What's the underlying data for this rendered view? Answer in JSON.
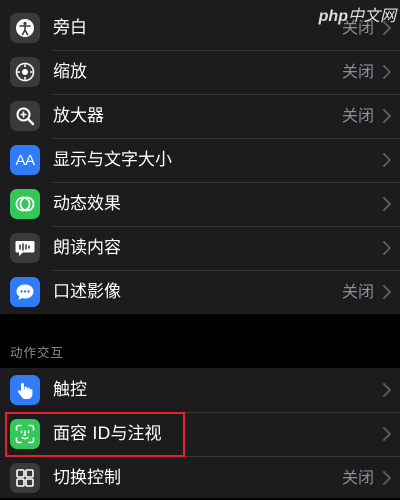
{
  "watermark": {
    "brand": "php",
    "site": "中文网"
  },
  "vision_group": {
    "items": [
      {
        "label": "旁白",
        "value": "关闭",
        "icon": "voiceover-icon",
        "icon_color": "#3a3a3c"
      },
      {
        "label": "缩放",
        "value": "关闭",
        "icon": "zoom-icon",
        "icon_color": "#3a3a3c"
      },
      {
        "label": "放大器",
        "value": "关闭",
        "icon": "magnifier-icon",
        "icon_color": "#3a3a3c"
      },
      {
        "label": "显示与文字大小",
        "value": "",
        "icon": "text-size-icon",
        "icon_glyph": "AA",
        "icon_color": "#2f7cf6"
      },
      {
        "label": "动态效果",
        "value": "",
        "icon": "motion-icon",
        "icon_color": "#34c759"
      },
      {
        "label": "朗读内容",
        "value": "",
        "icon": "spoken-content-icon",
        "icon_color": "#3a3a3c"
      },
      {
        "label": "口述影像",
        "value": "关闭",
        "icon": "audio-description-icon",
        "icon_color": "#2f7cf6"
      }
    ]
  },
  "motion_group": {
    "header": "动作交互",
    "items": [
      {
        "label": "触控",
        "value": "",
        "icon": "touch-icon",
        "icon_color": "#2f7cf6"
      },
      {
        "label": "面容 ID与注视",
        "value": "",
        "icon": "face-id-icon",
        "icon_color": "#34c759"
      },
      {
        "label": "切换控制",
        "value": "关闭",
        "icon": "switch-control-icon",
        "icon_color": "#3a3a3c"
      }
    ]
  },
  "colors": {
    "background": "#000000",
    "cell": "#1c1c1e",
    "separator": "#38383a",
    "secondary_text": "#8e8e93",
    "highlight_box": "#e2242a"
  }
}
